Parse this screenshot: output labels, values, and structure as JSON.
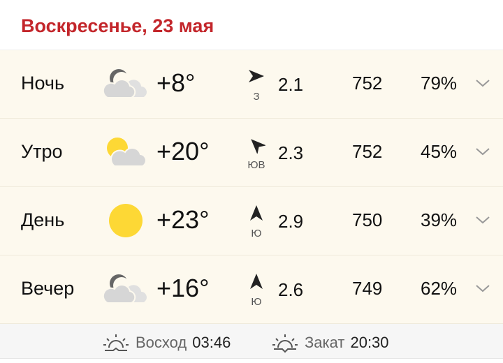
{
  "header": {
    "title": "Воскресенье, 23 мая"
  },
  "rows": [
    {
      "part": "Ночь",
      "icon": "moon-cloud-icon",
      "temp": "+8°",
      "wind_dir": "З",
      "wind_rotation_deg": 90,
      "wind_speed": "2.1",
      "pressure": "752",
      "humidity": "79%"
    },
    {
      "part": "Утро",
      "icon": "sun-cloud-icon",
      "temp": "+20°",
      "wind_dir": "ЮВ",
      "wind_rotation_deg": -45,
      "wind_speed": "2.3",
      "pressure": "752",
      "humidity": "45%"
    },
    {
      "part": "День",
      "icon": "sun-icon",
      "temp": "+23°",
      "wind_dir": "Ю",
      "wind_rotation_deg": 0,
      "wind_speed": "2.9",
      "pressure": "750",
      "humidity": "39%"
    },
    {
      "part": "Вечер",
      "icon": "moon-cloud-icon",
      "temp": "+16°",
      "wind_dir": "Ю",
      "wind_rotation_deg": 0,
      "wind_speed": "2.6",
      "pressure": "749",
      "humidity": "62%"
    }
  ],
  "footer": {
    "sunrise_label": "Восход",
    "sunrise": "03:46",
    "sunset_label": "Закат",
    "sunset": "20:30"
  },
  "colors": {
    "accent": "#c3262b",
    "row_bg": "#fdf9ee",
    "sun": "#fdd835",
    "cloud": "#d6d6d6"
  }
}
